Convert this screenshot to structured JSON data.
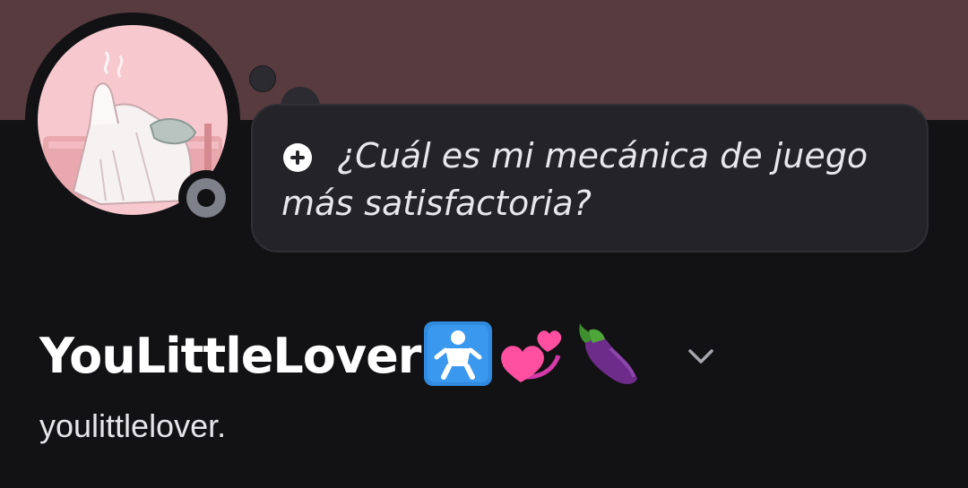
{
  "colors": {
    "banner": "#573b3f",
    "background": "#121214",
    "bubble": "#242428",
    "status_idle": "#7e8189"
  },
  "profile": {
    "status_bubble": {
      "icon": "plus-circle-icon",
      "text": "¿Cuál es mi mecánica de juego más satisfactoria?"
    },
    "display_name": "YouLittleLover",
    "display_name_emojis": [
      "baby-symbol-icon",
      "revolving-hearts-icon",
      "eggplant-icon"
    ],
    "username": "youlittlelover.",
    "status_indicator": "offline-icon",
    "expand_icon": "chevron-down-icon"
  }
}
